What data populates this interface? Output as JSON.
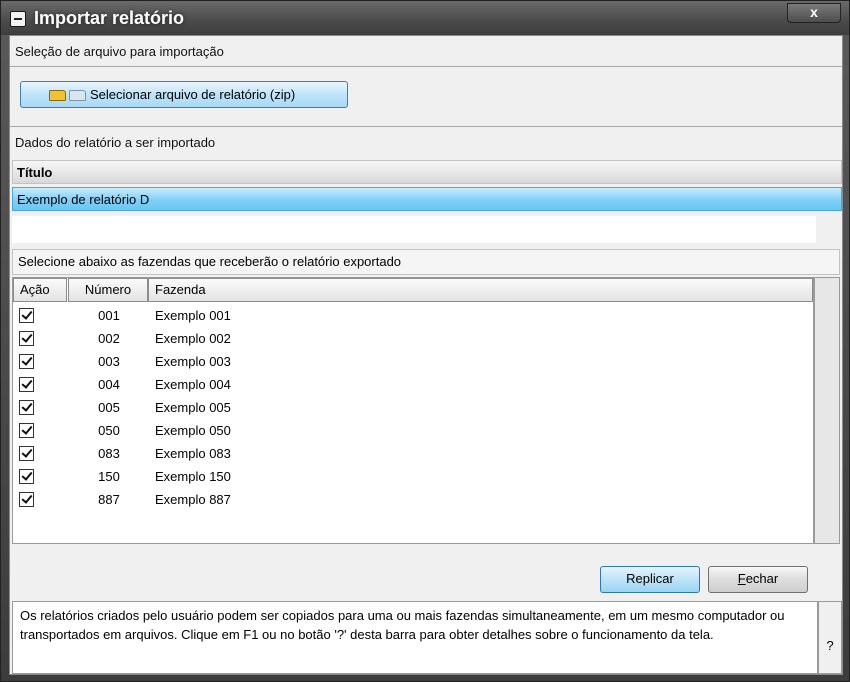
{
  "window": {
    "title": "Importar relatório",
    "close_label": "x"
  },
  "file_section": {
    "label": "Seleção de arquivo para importação",
    "select_button": "Selecionar arquivo de relatório (zip)",
    "icons": [
      "folder-open-icon",
      "folder-icon"
    ]
  },
  "report_section": {
    "label": "Dados do relatório a ser importado",
    "column_header": "Título",
    "selected_report": "Exemplo de relatório D"
  },
  "farms_section": {
    "caption": "Selecione abaixo as fazendas que receberão o relatório exportado",
    "columns": [
      "Ação",
      "Número",
      "Fazenda"
    ],
    "rows": [
      {
        "checked": true,
        "numero": "001",
        "fazenda": "Exemplo 001"
      },
      {
        "checked": true,
        "numero": "002",
        "fazenda": "Exemplo 002"
      },
      {
        "checked": true,
        "numero": "003",
        "fazenda": "Exemplo 003"
      },
      {
        "checked": true,
        "numero": "004",
        "fazenda": "Exemplo 004"
      },
      {
        "checked": true,
        "numero": "005",
        "fazenda": "Exemplo 005"
      },
      {
        "checked": true,
        "numero": "050",
        "fazenda": "Exemplo 050"
      },
      {
        "checked": true,
        "numero": "083",
        "fazenda": "Exemplo 083"
      },
      {
        "checked": true,
        "numero": "150",
        "fazenda": "Exemplo 150"
      },
      {
        "checked": true,
        "numero": "887",
        "fazenda": "Exemplo 887"
      }
    ]
  },
  "actions": {
    "replicar": "Replicar",
    "fechar_mnemonic": "F",
    "fechar_rest": "echar"
  },
  "help": {
    "text": "Os relatórios criados pelo usuário podem ser copiados para uma ou mais fazendas simultaneamente, em um mesmo computador ou transportados em arquivos. Clique em F1 ou no botão '?' desta barra para obter detalhes sobre o funcionamento da tela.",
    "button": "?"
  }
}
